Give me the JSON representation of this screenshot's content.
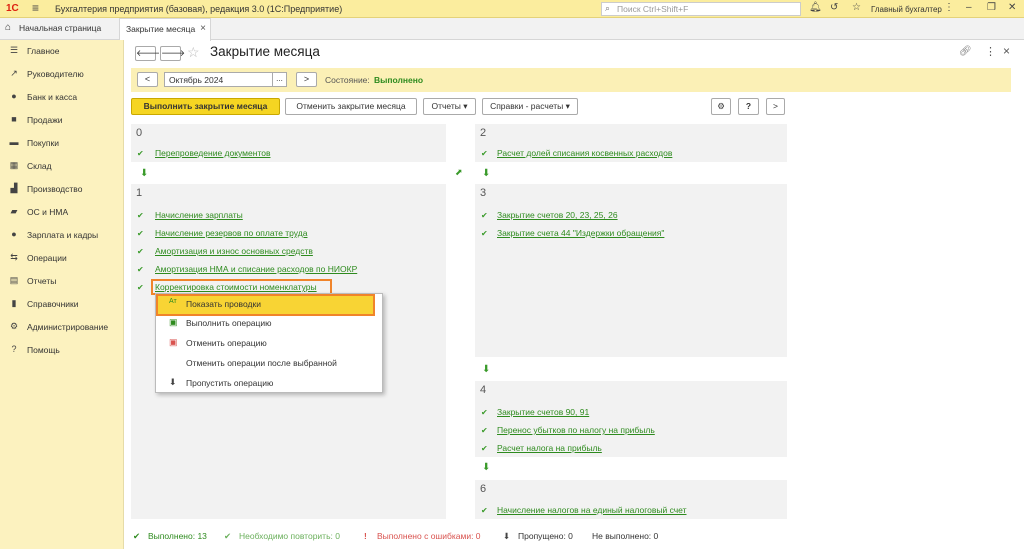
{
  "titlebar": {
    "logo": "1С",
    "app_title": "Бухгалтерия предприятия (базовая), редакция 3.0  (1С:Предприятие)",
    "search_placeholder": "Поиск Ctrl+Shift+F",
    "user": "Главный бухгалтер"
  },
  "tabs": {
    "home": "Начальная страница",
    "active": "Закрытие месяца"
  },
  "sidebar": {
    "items": [
      {
        "label": "Главное",
        "icon": "menu-icon"
      },
      {
        "label": "Руководителю",
        "icon": "chart-icon"
      },
      {
        "label": "Банк и касса",
        "icon": "bank-icon"
      },
      {
        "label": "Продажи",
        "icon": "sales-icon"
      },
      {
        "label": "Покупки",
        "icon": "cart-icon"
      },
      {
        "label": "Склад",
        "icon": "warehouse-icon"
      },
      {
        "label": "Производство",
        "icon": "factory-icon"
      },
      {
        "label": "ОС и НМА",
        "icon": "truck-icon"
      },
      {
        "label": "Зарплата и кадры",
        "icon": "person-icon"
      },
      {
        "label": "Операции",
        "icon": "operations-icon"
      },
      {
        "label": "Отчеты",
        "icon": "reports-icon"
      },
      {
        "label": "Справочники",
        "icon": "book-icon"
      },
      {
        "label": "Администрирование",
        "icon": "gear-icon"
      },
      {
        "label": "Помощь",
        "icon": "help-icon"
      }
    ]
  },
  "doc": {
    "title": "Закрытие месяца",
    "prev": "<",
    "month": "Октябрь 2024",
    "pick": "...",
    "next": ">",
    "state_label": "Состояние:",
    "state_value": "Выполнено"
  },
  "toolbar": {
    "run": "Выполнить закрытие месяца",
    "cancel": "Отменить закрытие месяца",
    "reports": "Отчеты",
    "references": "Справки - расчеты",
    "help": "?",
    "more": ">"
  },
  "stages": {
    "s0": {
      "num": "0",
      "items": [
        "Перепроведение документов"
      ]
    },
    "s1": {
      "num": "1",
      "items": [
        "Начисление зарплаты",
        "Начисление резервов по оплате труда",
        "Амортизация и износ основных средств",
        "Амортизация НМА и списание расходов по НИОКР",
        "Корректировка стоимости номенклатуры"
      ]
    },
    "s2": {
      "num": "2",
      "items": [
        "Расчет долей списания косвенных расходов"
      ]
    },
    "s3": {
      "num": "3",
      "items": [
        "Закрытие счетов 20, 23, 25, 26",
        "Закрытие счета 44 \"Издержки обращения\""
      ]
    },
    "s4": {
      "num": "4",
      "items": [
        "Закрытие счетов 90, 91",
        "Перенос убытков по налогу на прибыль",
        "Расчет налога на прибыль"
      ]
    },
    "s6": {
      "num": "6",
      "items": [
        "Начисление налогов на единый налоговый счет"
      ]
    }
  },
  "context_menu": [
    {
      "label": "Показать проводки",
      "icon": "postings-icon"
    },
    {
      "label": "Выполнить операцию",
      "icon": "execute-icon"
    },
    {
      "label": "Отменить операцию",
      "icon": "cancel-op-icon"
    },
    {
      "label": "Отменить операции после выбранной",
      "icon": ""
    },
    {
      "label": "Пропустить операцию",
      "icon": "skip-icon"
    }
  ],
  "footer": {
    "done": "Выполнено: 13",
    "repeat": "Необходимо повторить: 0",
    "errors": "Выполнено с ошибками: 0",
    "skipped": "Пропущено: 0",
    "not_done": "Не выполнено: 0"
  },
  "colors": {
    "accent_yellow": "#f5d522",
    "done_green": "#2e8b1e",
    "error_red": "#d9534f",
    "highlight_orange": "#f0842a"
  }
}
